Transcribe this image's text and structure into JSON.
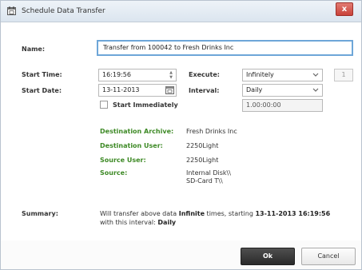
{
  "window": {
    "title": "Schedule Data Transfer",
    "close_label": "x"
  },
  "form": {
    "name_label": "Name:",
    "name_value": "Transfer from 100042 to Fresh Drinks Inc",
    "start_time_label": "Start Time:",
    "start_time_value": "16:19:56",
    "start_date_label": "Start Date:",
    "start_date_value": "13-11-2013",
    "execute_label": "Execute:",
    "execute_value": "Infinitely",
    "execute_count": "1",
    "interval_label": "Interval:",
    "interval_value": "Daily",
    "interval_duration": "1.00:00:00",
    "start_immediately_label": "Start Immediately"
  },
  "details": {
    "destination_archive_label": "Destination Archive:",
    "destination_archive_value": "Fresh Drinks Inc",
    "destination_user_label": "Destination User:",
    "destination_user_value": "2250Light",
    "source_user_label": "Source User:",
    "source_user_value": "2250Light",
    "source_label": "Source:",
    "source_value_1": "Internal Disk\\\\",
    "source_value_2": "SD-Card T\\\\"
  },
  "summary": {
    "label": "Summary:",
    "part1": "Will transfer above data ",
    "times_value": "Infinite",
    "part2": " times, starting ",
    "start_value": "13-11-2013 16:19:56",
    "part3": "with this interval: ",
    "interval_value": "Daily"
  },
  "buttons": {
    "ok_label": "Ok",
    "cancel_label": "Cancel"
  },
  "colors": {
    "accent_green": "#3e8a26",
    "focus_border": "#6ea6d8",
    "close_red": "#c9423a"
  },
  "icons": {
    "title": "schedule-calendar-icon",
    "date": "calendar-icon"
  }
}
